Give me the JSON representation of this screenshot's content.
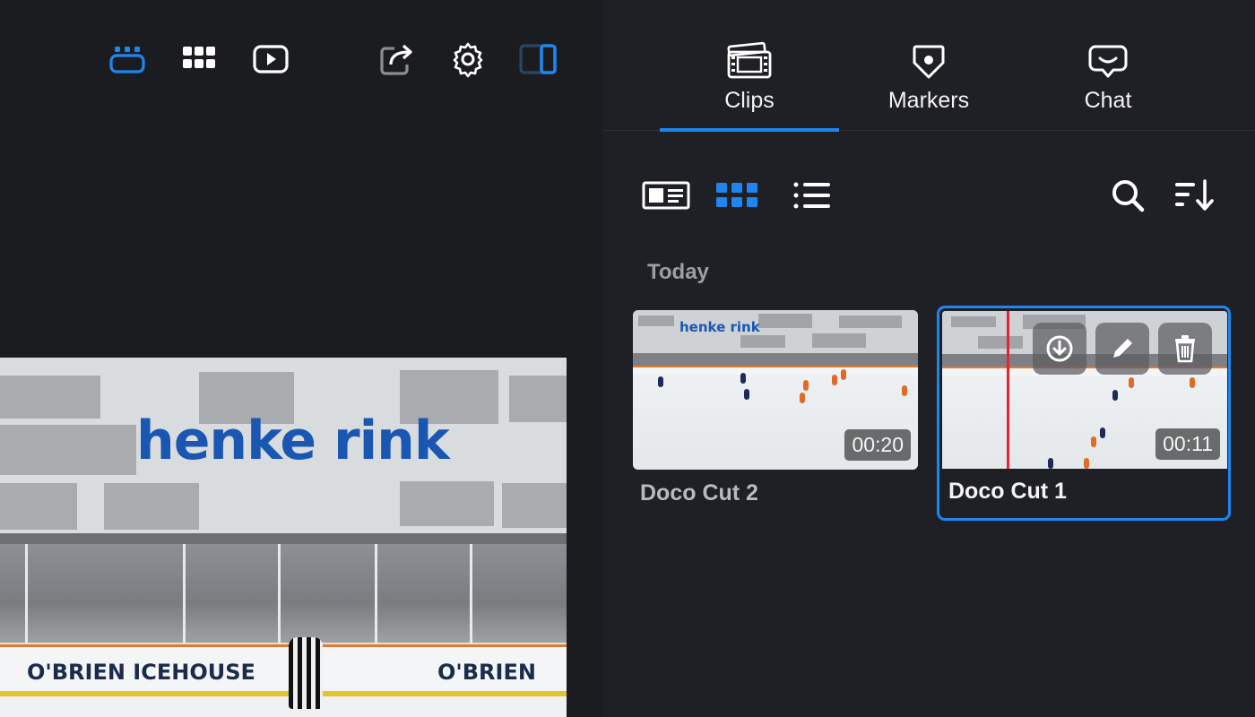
{
  "left_toolbar": {
    "icons": [
      "layout-panels-icon",
      "grid-icon",
      "play-icon",
      "share-icon",
      "settings-icon",
      "sidebar-toggle-icon"
    ],
    "active_icon": "layout-panels-icon"
  },
  "video": {
    "brand_text": "henke rink",
    "board_text_1": "O'BRIEN ICEHOUSE",
    "board_text_2": "O'BRIEN"
  },
  "tabs": [
    {
      "label": "Clips",
      "icon": "film-icon",
      "active": true
    },
    {
      "label": "Markers",
      "icon": "marker-pin-icon",
      "active": false
    },
    {
      "label": "Chat",
      "icon": "chat-bubble-icon",
      "active": false
    }
  ],
  "view_modes": {
    "options": [
      "card-view-icon",
      "grid-view-icon",
      "list-view-icon"
    ],
    "selected": "grid-view-icon"
  },
  "tools": [
    "search-icon",
    "sort-icon"
  ],
  "section": {
    "title": "Today"
  },
  "clips": [
    {
      "title": "Doco Cut 2",
      "duration": "00:20",
      "thumb_brand": "henke rink",
      "selected": false
    },
    {
      "title": "Doco Cut 1",
      "duration": "00:11",
      "selected": true,
      "actions": [
        "download-icon",
        "edit-icon",
        "delete-icon"
      ]
    }
  ],
  "colors": {
    "accent": "#1f86ef",
    "background": "#1b1c20",
    "panel": "#1f2025",
    "playhead": "#e8232c"
  }
}
